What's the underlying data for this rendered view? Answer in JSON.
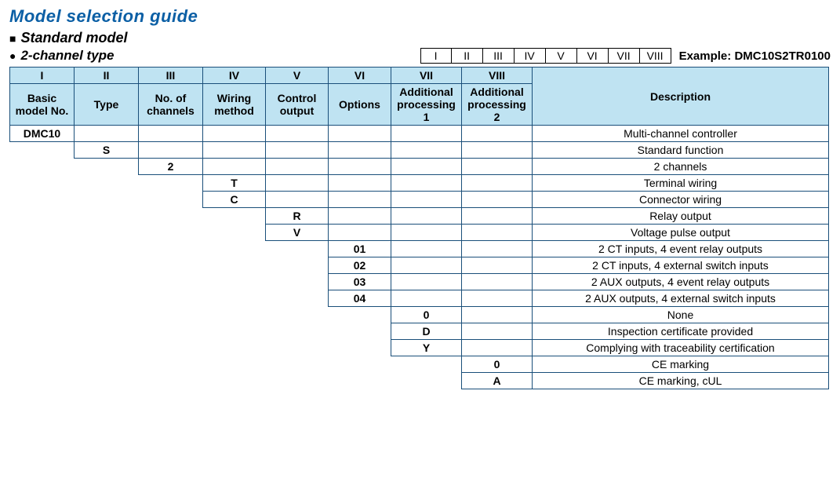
{
  "title": "Model selection guide",
  "sub1": "Standard model",
  "sub2": "2-channel type",
  "roman": [
    "I",
    "II",
    "III",
    "IV",
    "V",
    "VI",
    "VII",
    "VIII"
  ],
  "exampleLabel": "Example: DMC10S2TR0100",
  "head": {
    "r1": [
      "I",
      "II",
      "III",
      "IV",
      "V",
      "VI",
      "VII",
      "VIII",
      "Description"
    ],
    "r2": [
      "Basic model No.",
      "Type",
      "No. of channels",
      "Wiring method",
      "Control output",
      "Options",
      "Additional processing 1",
      "Additional processing 2"
    ]
  },
  "rows": [
    {
      "col": 0,
      "code": "DMC10",
      "desc": "Multi-channel controller"
    },
    {
      "col": 1,
      "code": "S",
      "desc": "Standard function"
    },
    {
      "col": 2,
      "code": "2",
      "desc": "2 channels"
    },
    {
      "col": 3,
      "code": "T",
      "desc": "Terminal wiring"
    },
    {
      "col": 3,
      "code": "C",
      "desc": "Connector wiring"
    },
    {
      "col": 4,
      "code": "R",
      "desc": "Relay output"
    },
    {
      "col": 4,
      "code": "V",
      "desc": "Voltage pulse output"
    },
    {
      "col": 5,
      "code": "01",
      "desc": "2 CT inputs, 4 event relay outputs"
    },
    {
      "col": 5,
      "code": "02",
      "desc": "2 CT inputs, 4 external switch inputs"
    },
    {
      "col": 5,
      "code": "03",
      "desc": "2 AUX outputs, 4 event relay outputs"
    },
    {
      "col": 5,
      "code": "04",
      "desc": "2 AUX outputs, 4 external switch inputs"
    },
    {
      "col": 6,
      "code": "0",
      "desc": "None"
    },
    {
      "col": 6,
      "code": "D",
      "desc": "Inspection  certificate provided"
    },
    {
      "col": 6,
      "code": "Y",
      "desc": "Complying with traceability  certification"
    },
    {
      "col": 7,
      "code": "0",
      "desc": "CE marking"
    },
    {
      "col": 7,
      "code": "A",
      "desc": "CE marking, cUL"
    }
  ]
}
